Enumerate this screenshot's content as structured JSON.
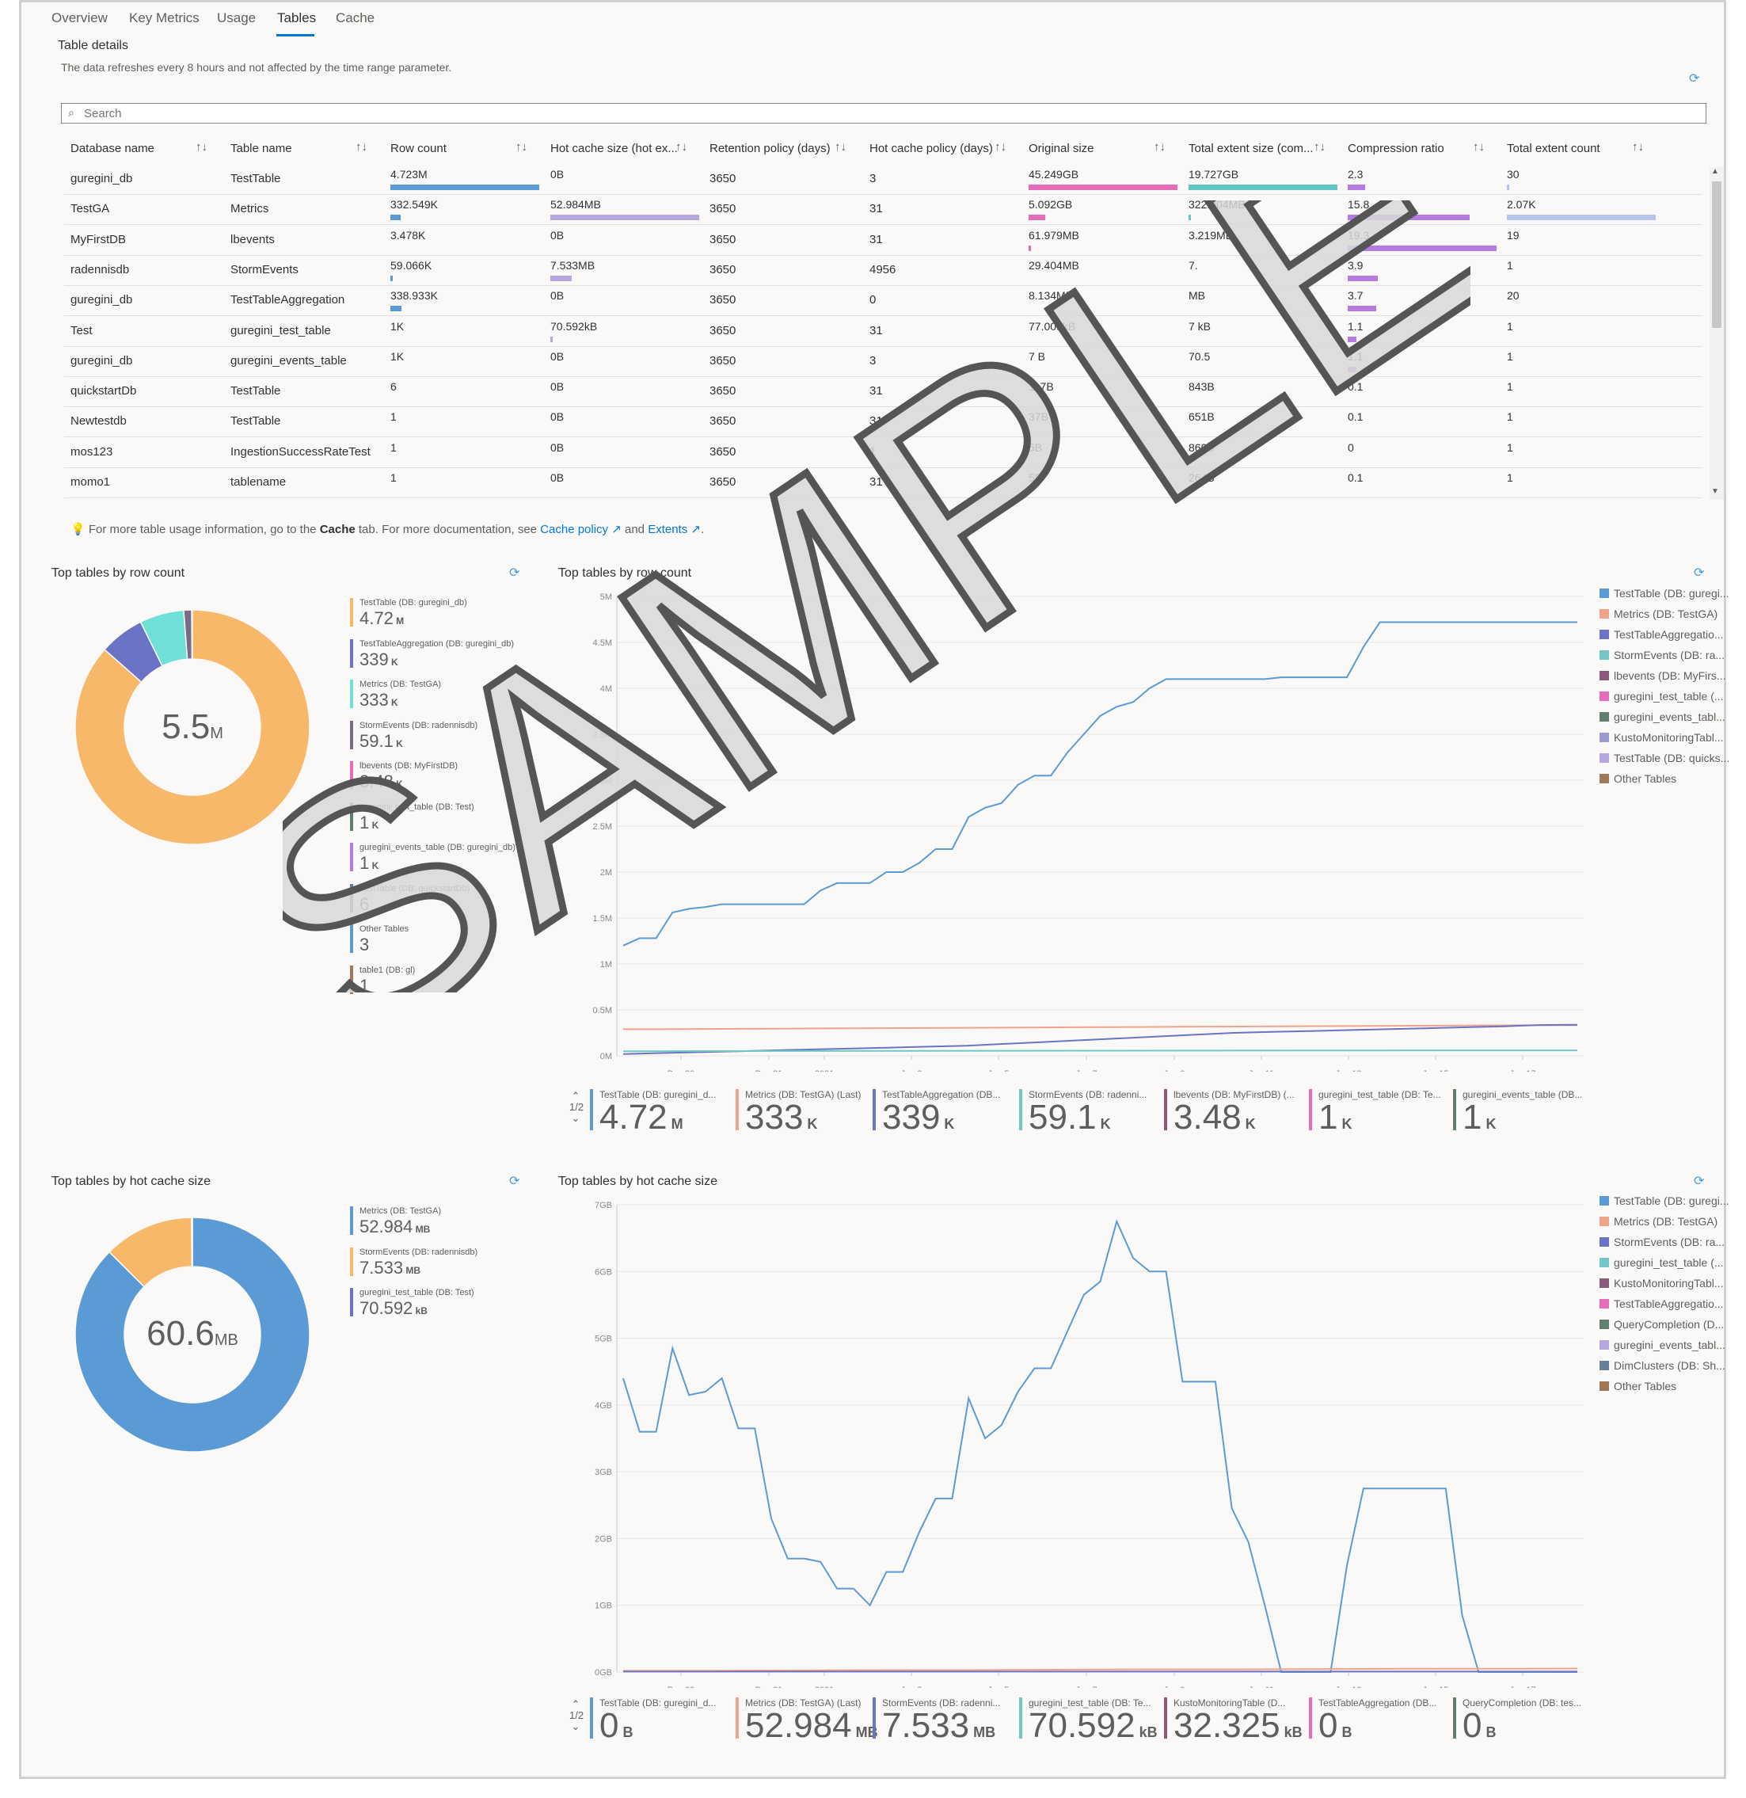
{
  "tabs": [
    "Overview",
    "Key Metrics",
    "Usage",
    "Tables",
    "Cache"
  ],
  "active_tab": "Tables",
  "section": {
    "title": "Table details",
    "subtitle": "The data refreshes every 8 hours and not affected by the time range parameter."
  },
  "search": {
    "placeholder": "Search",
    "value": ""
  },
  "table": {
    "columns": [
      "Database name",
      "Table name",
      "Row count",
      "Hot cache size (hot ex...",
      "Retention policy (days)",
      "Hot cache policy (days)",
      "Original size",
      "Total extent size (com...",
      "Compression ratio",
      "Total extent count"
    ],
    "rows": [
      {
        "db": "guregini_db",
        "table": "TestTable",
        "rows": "4.723M",
        "hot": "0B",
        "retention": "3650",
        "hotpolicy": "3",
        "orig": "45.249GB",
        "extent": "19.727GB",
        "ratio": "2.3",
        "count": "30"
      },
      {
        "db": "TestGA",
        "table": "Metrics",
        "rows": "332.549K",
        "hot": "52.984MB",
        "retention": "3650",
        "hotpolicy": "31",
        "orig": "5.092GB",
        "extent": "322.004MB",
        "ratio": "15.8",
        "count": "2.07K"
      },
      {
        "db": "MyFirstDB",
        "table": "lbevents",
        "rows": "3.478K",
        "hot": "0B",
        "retention": "3650",
        "hotpolicy": "31",
        "orig": "61.979MB",
        "extent": "3.219MB",
        "ratio": "19.3",
        "count": "19"
      },
      {
        "db": "radennisdb",
        "table": "StormEvents",
        "rows": "59.066K",
        "hot": "7.533MB",
        "retention": "3650",
        "hotpolicy": "4956",
        "orig": "29.404MB",
        "extent": "7.",
        "ratio": "3.9",
        "count": "1"
      },
      {
        "db": "guregini_db",
        "table": "TestTableAggregation",
        "rows": "338.933K",
        "hot": "0B",
        "retention": "3650",
        "hotpolicy": "0",
        "orig": "8.134MB",
        "extent": "MB",
        "ratio": "3.7",
        "count": "20"
      },
      {
        "db": "Test",
        "table": "guregini_test_table",
        "rows": "1K",
        "hot": "70.592kB",
        "retention": "3650",
        "hotpolicy": "31",
        "orig": "77.009kB",
        "extent": "7   kB",
        "ratio": "1.1",
        "count": "1"
      },
      {
        "db": "guregini_db",
        "table": "guregini_events_table",
        "rows": "1K",
        "hot": "0B",
        "retention": "3650",
        "hotpolicy": "3",
        "orig": "7   B",
        "extent": "70.5",
        "ratio": "1.1",
        "count": "1"
      },
      {
        "db": "quickstartDb",
        "table": "TestTable",
        "rows": "6",
        "hot": "0B",
        "retention": "3650",
        "hotpolicy": "31",
        "orig": "117B",
        "extent": "843B",
        "ratio": "0.1",
        "count": "1"
      },
      {
        "db": "Newtestdb",
        "table": "TestTable",
        "rows": "1",
        "hot": "0B",
        "retention": "3650",
        "hotpolicy": "31",
        "orig": "37B",
        "extent": "651B",
        "ratio": "0.1",
        "count": "1"
      },
      {
        "db": "mos123",
        "table": "IngestionSuccessRateTest",
        "rows": "1",
        "hot": "0B",
        "retention": "3650",
        "hotpolicy": "1",
        "orig": "5B",
        "extent": "860B",
        "ratio": "0",
        "count": "1"
      },
      {
        "db": "momo1",
        "table": "tablename",
        "rows": "1",
        "hot": "0B",
        "retention": "3650",
        "hotpolicy": "31",
        "orig": "5B",
        "extent": "264B",
        "ratio": "0.1",
        "count": "1"
      }
    ],
    "bars": {
      "rows": [
        1.0,
        0.07,
        0.0,
        0.0125,
        0.072,
        0.0,
        0.0,
        0.0,
        0.0,
        0.0,
        0.0
      ],
      "hot": [
        0.0,
        1.0,
        0.0,
        0.142,
        0.0,
        0.0013,
        0.0,
        0.0,
        0.0,
        0.0,
        0.0
      ],
      "orig": [
        1.0,
        0.113,
        0.0014,
        0.0,
        0.0,
        0.0,
        0.0,
        0.0,
        0.0,
        0.0,
        0.0
      ],
      "extent": [
        1.0,
        0.0163,
        0.0,
        0.0,
        0.0,
        0.0,
        0.0,
        0.0,
        0.0,
        0.0,
        0.0
      ],
      "ratio": [
        0.119,
        0.819,
        1.0,
        0.202,
        0.192,
        0.057,
        0.057,
        0.0,
        0.0,
        0.0,
        0.0
      ],
      "count": [
        0.0145,
        1.0,
        0.0,
        0.0,
        0.0,
        0.0,
        0.0,
        0.0,
        0.0,
        0.0,
        0.0
      ]
    }
  },
  "note": {
    "prefix": "For more table usage information, go to the ",
    "bold": "Cache",
    "middle": " tab. For more documentation, see ",
    "link1": "Cache policy",
    "and": " and ",
    "link2": "Extents",
    "end": "."
  },
  "colors": {
    "blue": "#5b9bd5",
    "orange": "#f8b86a",
    "purple": "#6b74c4",
    "teal": "#6fe0d8",
    "pink": "#e36db6",
    "salmon": "#f0a58a",
    "lightpurple": "#b4a7e0",
    "violet": "#b57be0",
    "green": "#5f7f6f",
    "slate": "#687f99",
    "brown": "#a07858"
  },
  "row_count_donut": {
    "title": "Top tables by row count",
    "total": "5.5",
    "unit": "M",
    "legend": [
      {
        "label": "TestTable (DB: guregini_db)",
        "value": "4.72",
        "unit": "M",
        "color": "#f8b86a"
      },
      {
        "label": "TestTableAggregation (DB: guregini_db)",
        "value": "339",
        "unit": "K",
        "color": "#6b74c4"
      },
      {
        "label": "Metrics (DB: TestGA)",
        "value": "333",
        "unit": "K",
        "color": "#6fe0d8"
      },
      {
        "label": "StormEvents (DB: radennisdb)",
        "value": "59.1",
        "unit": "K",
        "color": "#7a6a8a"
      },
      {
        "label": "lbevents (DB: MyFirstDB)",
        "value": "3.48",
        "unit": "K",
        "color": "#e36db6"
      },
      {
        "label": "guregini_test_table (DB: Test)",
        "value": "1",
        "unit": "K",
        "color": "#5f7f6f"
      },
      {
        "label": "guregini_events_table (DB: guregini_db)",
        "value": "1",
        "unit": "K",
        "color": "#b57be0"
      },
      {
        "label": "TestTable (DB: quickstartDb)",
        "value": "6",
        "unit": "",
        "color": "#687f99"
      },
      {
        "label": "Other Tables",
        "value": "3",
        "unit": "",
        "color": "#5b9bd5"
      },
      {
        "label": "table1 (DB: gl)",
        "value": "1",
        "unit": "",
        "color": "#a07858"
      }
    ]
  },
  "row_count_chart": {
    "title": "Top tables by row count",
    "legend": [
      "TestTable (DB: guregi...",
      "Metrics (DB: TestGA)",
      "TestTableAggregatio...",
      "StormEvents (DB: ra...",
      "lbevents (DB: MyFirs...",
      "guregini_test_table (...",
      "guregini_events_tabl...",
      "KustoMonitoringTabl...",
      "TestTable (DB: quicks...",
      "Other Tables"
    ],
    "bottom_pager": "1/2",
    "bottom": [
      {
        "label": "TestTable (DB: guregini_d...",
        "value": "4.72",
        "unit": "M",
        "color": "#5b9bd5"
      },
      {
        "label": "Metrics (DB: TestGA) (Last)",
        "value": "333",
        "unit": "K",
        "color": "#f0a58a"
      },
      {
        "label": "TestTableAggregation (DB...",
        "value": "339",
        "unit": "K",
        "color": "#6b74c4"
      },
      {
        "label": "StormEvents (DB: radenni...",
        "value": "59.1",
        "unit": "K",
        "color": "#6fc7c7"
      },
      {
        "label": "lbevents (DB: MyFirstDB) (...",
        "value": "3.48",
        "unit": "K",
        "color": "#8a5a7a"
      },
      {
        "label": "guregini_test_table (DB: Te...",
        "value": "1",
        "unit": "K",
        "color": "#e36db6"
      },
      {
        "label": "guregini_events_table (DB...",
        "value": "1",
        "unit": "K",
        "color": "#5f7f6f"
      }
    ]
  },
  "hot_cache_donut": {
    "title": "Top tables by hot cache size",
    "total": "60.6",
    "unit": "MB",
    "legend": [
      {
        "label": "Metrics (DB: TestGA)",
        "value": "52.984",
        "unit": "MB",
        "color": "#5b9bd5"
      },
      {
        "label": "StormEvents (DB: radennisdb)",
        "value": "7.533",
        "unit": "MB",
        "color": "#f8b86a"
      },
      {
        "label": "guregini_test_table (DB: Test)",
        "value": "70.592",
        "unit": "kB",
        "color": "#6b74c4"
      }
    ]
  },
  "hot_cache_chart": {
    "title": "Top tables by hot cache size",
    "legend": [
      "TestTable (DB: guregi...",
      "Metrics (DB: TestGA)",
      "StormEvents (DB: ra...",
      "guregini_test_table (...",
      "KustoMonitoringTabl...",
      "TestTableAggregatio...",
      "QueryCompletion (D...",
      "guregini_events_tabl...",
      "DimClusters (DB: Sh...",
      "Other Tables"
    ],
    "bottom_pager": "1/2",
    "bottom": [
      {
        "label": "TestTable (DB: guregini_d...",
        "value": "0",
        "unit": "B",
        "color": "#5b9bd5"
      },
      {
        "label": "Metrics (DB: TestGA) (Last)",
        "value": "52.984",
        "unit": "MB",
        "color": "#f0a58a"
      },
      {
        "label": "StormEvents (DB: radenni...",
        "value": "7.533",
        "unit": "MB",
        "color": "#6b74c4"
      },
      {
        "label": "guregini_test_table (DB: Te...",
        "value": "70.592",
        "unit": "kB",
        "color": "#6fc7c7"
      },
      {
        "label": "KustoMonitoringTable (D...",
        "value": "32.325",
        "unit": "kB",
        "color": "#8a5a7a"
      },
      {
        "label": "TestTableAggregation (DB...",
        "value": "0",
        "unit": "B",
        "color": "#e36db6"
      },
      {
        "label": "QueryCompletion (DB: tes...",
        "value": "0",
        "unit": "B",
        "color": "#5f7f6f"
      }
    ]
  },
  "chart_data": [
    {
      "type": "pie",
      "title": "Top tables by row count",
      "categories": [
        "TestTable (DB: guregini_db)",
        "TestTableAggregation (DB: guregini_db)",
        "Metrics (DB: TestGA)",
        "StormEvents (DB: radennisdb)",
        "lbevents (DB: MyFirstDB)",
        "guregini_test_table (DB: Test)",
        "guregini_events_table (DB: guregini_db)",
        "TestTable (DB: quickstartDb)",
        "Other Tables",
        "table1 (DB: gl)"
      ],
      "values": [
        4720000,
        339000,
        333000,
        59100,
        3480,
        1000,
        1000,
        6,
        3,
        1
      ]
    },
    {
      "type": "line",
      "title": "Top tables by row count",
      "x_ticks": [
        "Dec 29",
        "Dec 31",
        "2021",
        "Jan 3",
        "Jan 5",
        "Jan 7",
        "Jan 9",
        "Jan 11",
        "Jan 13",
        "Jan 15",
        "Jan 17"
      ],
      "y_ticks": [
        "0M",
        "0.5M",
        "1M",
        "1.5M",
        "2M",
        "2.5M",
        "3M",
        "3.5M",
        "4M",
        "4.5M",
        "5M"
      ],
      "ylim": [
        0,
        5000000
      ],
      "series": [
        {
          "name": "TestTable (DB: guregini_db)",
          "color": "#5b9bd5",
          "values": [
            1200000,
            1280000,
            1280000,
            1560000,
            1600000,
            1620000,
            1650000,
            1650000,
            1650000,
            1650000,
            1650000,
            1650000,
            1800000,
            1880000,
            1880000,
            1880000,
            2000000,
            2000000,
            2100000,
            2250000,
            2250000,
            2600000,
            2700000,
            2750000,
            2950000,
            3050000,
            3050000,
            3300000,
            3500000,
            3700000,
            3800000,
            3850000,
            4000000,
            4100000,
            4100000,
            4100000,
            4100000,
            4100000,
            4100000,
            4100000,
            4120000,
            4120000,
            4120000,
            4120000,
            4120000,
            4450000,
            4720000,
            4720000,
            4720000,
            4720000,
            4720000,
            4720000,
            4720000,
            4720000,
            4720000,
            4720000,
            4720000,
            4720000,
            4720000
          ]
        },
        {
          "name": "Metrics (DB: TestGA)",
          "color": "#f0a58a",
          "values": [
            290000,
            290000,
            292000,
            294000,
            296000,
            298000,
            300000,
            302000,
            304000,
            306000,
            308000,
            310000,
            312000,
            314000,
            316000,
            318000,
            320000,
            322000,
            324000,
            326000,
            328000,
            330000,
            332000,
            333000,
            333000
          ]
        },
        {
          "name": "TestTableAggregation (DB: guregini_db)",
          "color": "#6b74c4",
          "values": [
            20000,
            30000,
            40000,
            50000,
            60000,
            70000,
            80000,
            90000,
            100000,
            110000,
            130000,
            150000,
            170000,
            190000,
            210000,
            230000,
            250000,
            260000,
            270000,
            280000,
            290000,
            300000,
            310000,
            320000,
            335000,
            339000
          ]
        },
        {
          "name": "StormEvents (DB: radennisdb)",
          "color": "#6fc7c7",
          "values": [
            50000,
            52000,
            53000,
            54000,
            55000,
            56000,
            57000,
            58000,
            59000,
            59066,
            59066
          ]
        }
      ]
    },
    {
      "type": "pie",
      "title": "Top tables by hot cache size",
      "categories": [
        "Metrics (DB: TestGA)",
        "StormEvents (DB: radennisdb)",
        "guregini_test_table (DB: Test)"
      ],
      "values": [
        52.984,
        7.533,
        0.0706
      ]
    },
    {
      "type": "line",
      "title": "Top tables by hot cache size",
      "x_ticks": [
        "Dec 29",
        "Dec 31",
        "2021",
        "Jan 3",
        "Jan 5",
        "Jan 7",
        "Jan 9",
        "Jan 11",
        "Jan 13",
        "Jan 15",
        "Jan 17"
      ],
      "y_ticks": [
        "0GB",
        "1GB",
        "2GB",
        "3GB",
        "4GB",
        "5GB",
        "6GB",
        "7GB"
      ],
      "ylim": [
        0,
        7
      ],
      "series": [
        {
          "name": "TestTable (DB: guregini_db)",
          "color": "#5b9bd5",
          "values": [
            4.4,
            3.6,
            3.6,
            4.85,
            4.15,
            4.2,
            4.4,
            3.65,
            3.65,
            2.3,
            1.7,
            1.7,
            1.65,
            1.25,
            1.25,
            1.0,
            1.5,
            1.5,
            2.1,
            2.6,
            2.6,
            4.1,
            3.5,
            3.7,
            4.2,
            4.55,
            4.55,
            5.1,
            5.65,
            5.85,
            6.75,
            6.2,
            6.0,
            6.0,
            4.35,
            4.35,
            4.35,
            2.45,
            1.95,
            1.0,
            0.0,
            0.0,
            0.0,
            0.0,
            1.6,
            2.75,
            2.75,
            2.75,
            2.75,
            2.75,
            2.75,
            0.85,
            0.0,
            0.0,
            0.0,
            0.0,
            0.0,
            0.0,
            0.0
          ]
        },
        {
          "name": "Metrics (DB: TestGA)",
          "color": "#f0a58a",
          "values": [
            0.02,
            0.02,
            0.025,
            0.03,
            0.03,
            0.035,
            0.04,
            0.04,
            0.045,
            0.05,
            0.05,
            0.053
          ]
        },
        {
          "name": "StormEvents (DB: radennisdb)",
          "color": "#6b74c4",
          "values": [
            0.007,
            0.007,
            0.007,
            0.0075,
            0.0075
          ]
        }
      ]
    }
  ]
}
